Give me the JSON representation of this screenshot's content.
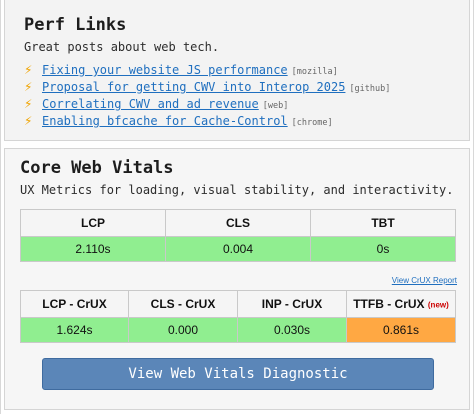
{
  "perf_links": {
    "title": "Perf Links",
    "subtitle": "Great posts about web tech.",
    "icon": "lightning-bolt-icon",
    "items": [
      {
        "text": "Fixing your website JS performance",
        "tag": "[mozilla]"
      },
      {
        "text": "Proposal for getting CWV into Interop 2025",
        "tag": "[github]"
      },
      {
        "text": "Correlating CWV and ad revenue",
        "tag": "[web]"
      },
      {
        "text": "Enabling bfcache for Cache-Control",
        "tag": "[chrome]"
      }
    ]
  },
  "core_web_vitals": {
    "title": "Core Web Vitals",
    "subtitle": "UX Metrics for loading, visual stability, and interactivity.",
    "lab_table": {
      "headers": [
        "LCP",
        "CLS",
        "TBT"
      ],
      "values": [
        "2.110s",
        "0.004",
        "0s"
      ]
    },
    "crux_link": "View CrUX Report",
    "crux_table": {
      "headers": [
        "LCP - CrUX",
        "CLS - CrUX",
        "INP - CrUX",
        "TTFB - CrUX"
      ],
      "new_badge": "(new)",
      "values": [
        "1.624s",
        "0.000",
        "0.030s",
        "0.861s"
      ]
    },
    "button_label": "View Web Vitals Diagnostic"
  },
  "colors": {
    "good": "#90ee90",
    "needs_improvement": "#ffa843",
    "link": "#1f6fbf",
    "button": "#5b86b8"
  }
}
